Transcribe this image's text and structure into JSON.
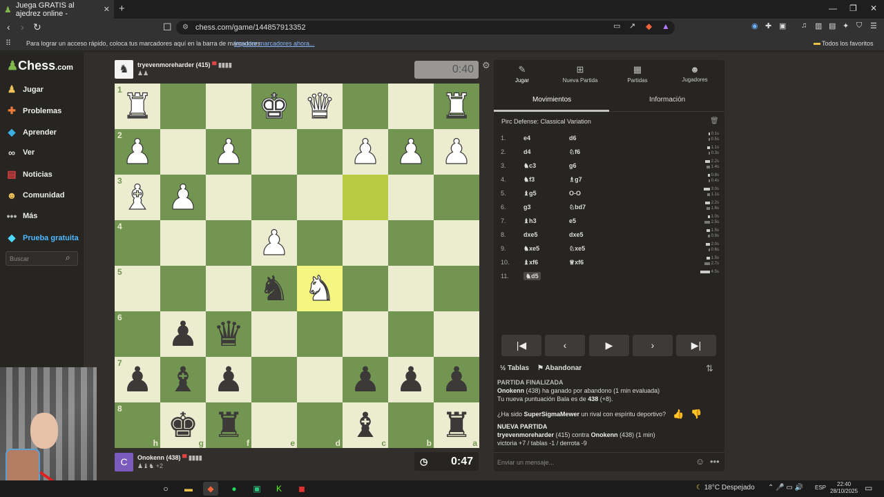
{
  "browser": {
    "tab_title": "Juega GRATIS al ajedrez online - ",
    "url": "chess.com/game/144857913352",
    "bookmarks_text": "Para lograr un acceso rápido, coloca tus marcadores aquí en la barra de marcadores.",
    "bookmarks_import": "Importar marcadores ahora...",
    "all_favorites": "Todos los favoritos"
  },
  "sidebar": {
    "logo_prefix": "Chess",
    "logo_suffix": ".com",
    "items": [
      {
        "label": "Jugar",
        "icon": "pawn-icon"
      },
      {
        "label": "Problemas",
        "icon": "puzzle-icon"
      },
      {
        "label": "Aprender",
        "icon": "graduation-cap-icon"
      },
      {
        "label": "Ver",
        "icon": "binoculars-icon"
      },
      {
        "label": "Noticias",
        "icon": "newspaper-icon"
      },
      {
        "label": "Comunidad",
        "icon": "community-icon"
      },
      {
        "label": "Más",
        "icon": "more-dots-icon"
      },
      {
        "label": "Prueba gratuita",
        "icon": "diamond-icon"
      }
    ],
    "search_placeholder": "Buscar"
  },
  "opponent": {
    "name": "tryevenmoreharder (415)",
    "clock": "0:40"
  },
  "player": {
    "name": "Onokenn (438)",
    "captured_extra": "+2",
    "clock": "0:47"
  },
  "board": {
    "ranks": [
      "1",
      "2",
      "3",
      "4",
      "5",
      "6",
      "7",
      "8"
    ],
    "files": [
      "h",
      "g",
      "f",
      "e",
      "d",
      "c",
      "b",
      "a"
    ],
    "rows": [
      [
        "R",
        "",
        "",
        "K",
        "Q",
        "",
        "",
        "R"
      ],
      [
        "P",
        "",
        "P",
        "",
        "",
        "P",
        "P",
        "P"
      ],
      [
        "B",
        "P",
        "",
        "",
        "",
        "",
        "",
        ""
      ],
      [
        "",
        "",
        "",
        "P",
        "",
        "",
        "",
        ""
      ],
      [
        "",
        "",
        "",
        "n",
        "N",
        "",
        "",
        ""
      ],
      [
        "",
        "p",
        "q",
        "",
        "",
        "",
        "",
        ""
      ],
      [
        "p",
        "b",
        "p",
        "",
        "",
        "p",
        "p",
        "p"
      ],
      [
        "",
        "k",
        "r",
        "",
        "",
        "b",
        "",
        "r"
      ]
    ],
    "highlight_from": [
      2,
      5
    ],
    "highlight_to": [
      4,
      4
    ]
  },
  "panel": {
    "tabs": [
      "Jugar",
      "Nueva Partida",
      "Partidas",
      "Jugadores"
    ],
    "subtabs": [
      "Movimientos",
      "Información"
    ],
    "opening": "Pirc Defense: Classical Variation",
    "moves": [
      {
        "n": "1.",
        "w": "e4",
        "b": "d6",
        "tw": "0.1s",
        "tb": "0.5s"
      },
      {
        "n": "2.",
        "w": "d4",
        "b": "♘f6",
        "tw": "1.1s",
        "tb": "0.3s"
      },
      {
        "n": "3.",
        "w": "♞c3",
        "b": "g6",
        "tw": "2.2s",
        "tb": "1.4s"
      },
      {
        "n": "4.",
        "w": "♞f3",
        "b": "♗g7",
        "tw": "0.8s",
        "tb": "0.4s"
      },
      {
        "n": "5.",
        "w": "♝g5",
        "b": "O-O",
        "tw": "3.0s",
        "tb": "1.1s"
      },
      {
        "n": "6.",
        "w": "g3",
        "b": "♘bd7",
        "tw": "2.2s",
        "tb": "1.6s"
      },
      {
        "n": "7.",
        "w": "♝h3",
        "b": "e5",
        "tw": "1.0s",
        "tb": "2.5s"
      },
      {
        "n": "8.",
        "w": "dxe5",
        "b": "dxe5",
        "tw": "1.5s",
        "tb": "0.9s"
      },
      {
        "n": "9.",
        "w": "♞xe5",
        "b": "♘xe5",
        "tw": "2.0s",
        "tb": "0.6s"
      },
      {
        "n": "10.",
        "w": "♝xf6",
        "b": "♕xf6",
        "tw": "1.5s",
        "tb": "2.7s"
      },
      {
        "n": "11.",
        "w": "♞d5",
        "b": "",
        "tw": "4.5s",
        "tb": ""
      }
    ],
    "draw_label": "Tablas",
    "resign_label": "Abandonar",
    "chat": {
      "game_over": "PARTIDA FINALIZADA",
      "result_name": "Onokenn",
      "result_text": " (438) ha ganado por abandono (1 min evaluada)",
      "rating_text": "Tu nueva puntuación Bala es de ",
      "rating_value": "438",
      "rating_delta": " (+8).",
      "sport_q1": "¿Ha sido ",
      "sport_name": "SuperSigmaMewer",
      "sport_q2": " un rival con espíritu deportivo?",
      "new_game": "NUEVA PARTIDA",
      "ng_name1": "tryevenmoreharder",
      "ng_mid": " (415) contra ",
      "ng_name2": "Onokenn",
      "ng_end": " (438) (1 min)",
      "ng_stats": "victoria +7 / tablas -1 / derrota -9"
    },
    "chat_placeholder": "Enviar un mensaje..."
  },
  "taskbar": {
    "weather": "18°C  Despejado",
    "lang": "ESP",
    "time": "22:40",
    "date": "28/10/2025"
  }
}
